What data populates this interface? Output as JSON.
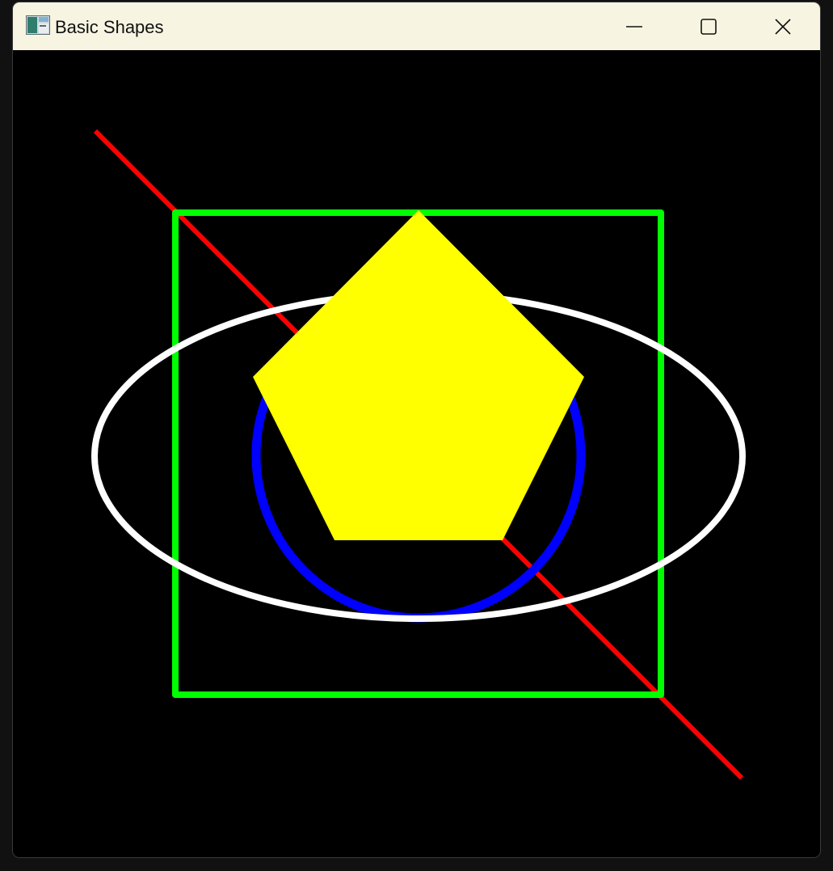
{
  "window": {
    "title": "Basic Shapes",
    "icon": "app-window-icon",
    "controls": {
      "minimize_icon": "minimize-icon",
      "maximize_icon": "maximize-icon",
      "close_icon": "close-icon"
    }
  },
  "canvas": {
    "background": "#000000",
    "shapes": [
      {
        "type": "line",
        "color": "#ff0000"
      },
      {
        "type": "rectangle",
        "color": "#00ff00"
      },
      {
        "type": "circle",
        "color": "#0000ff"
      },
      {
        "type": "ellipse",
        "color": "#ffffff"
      },
      {
        "type": "pentagon",
        "color": "#ffff00",
        "filled": true
      }
    ]
  }
}
